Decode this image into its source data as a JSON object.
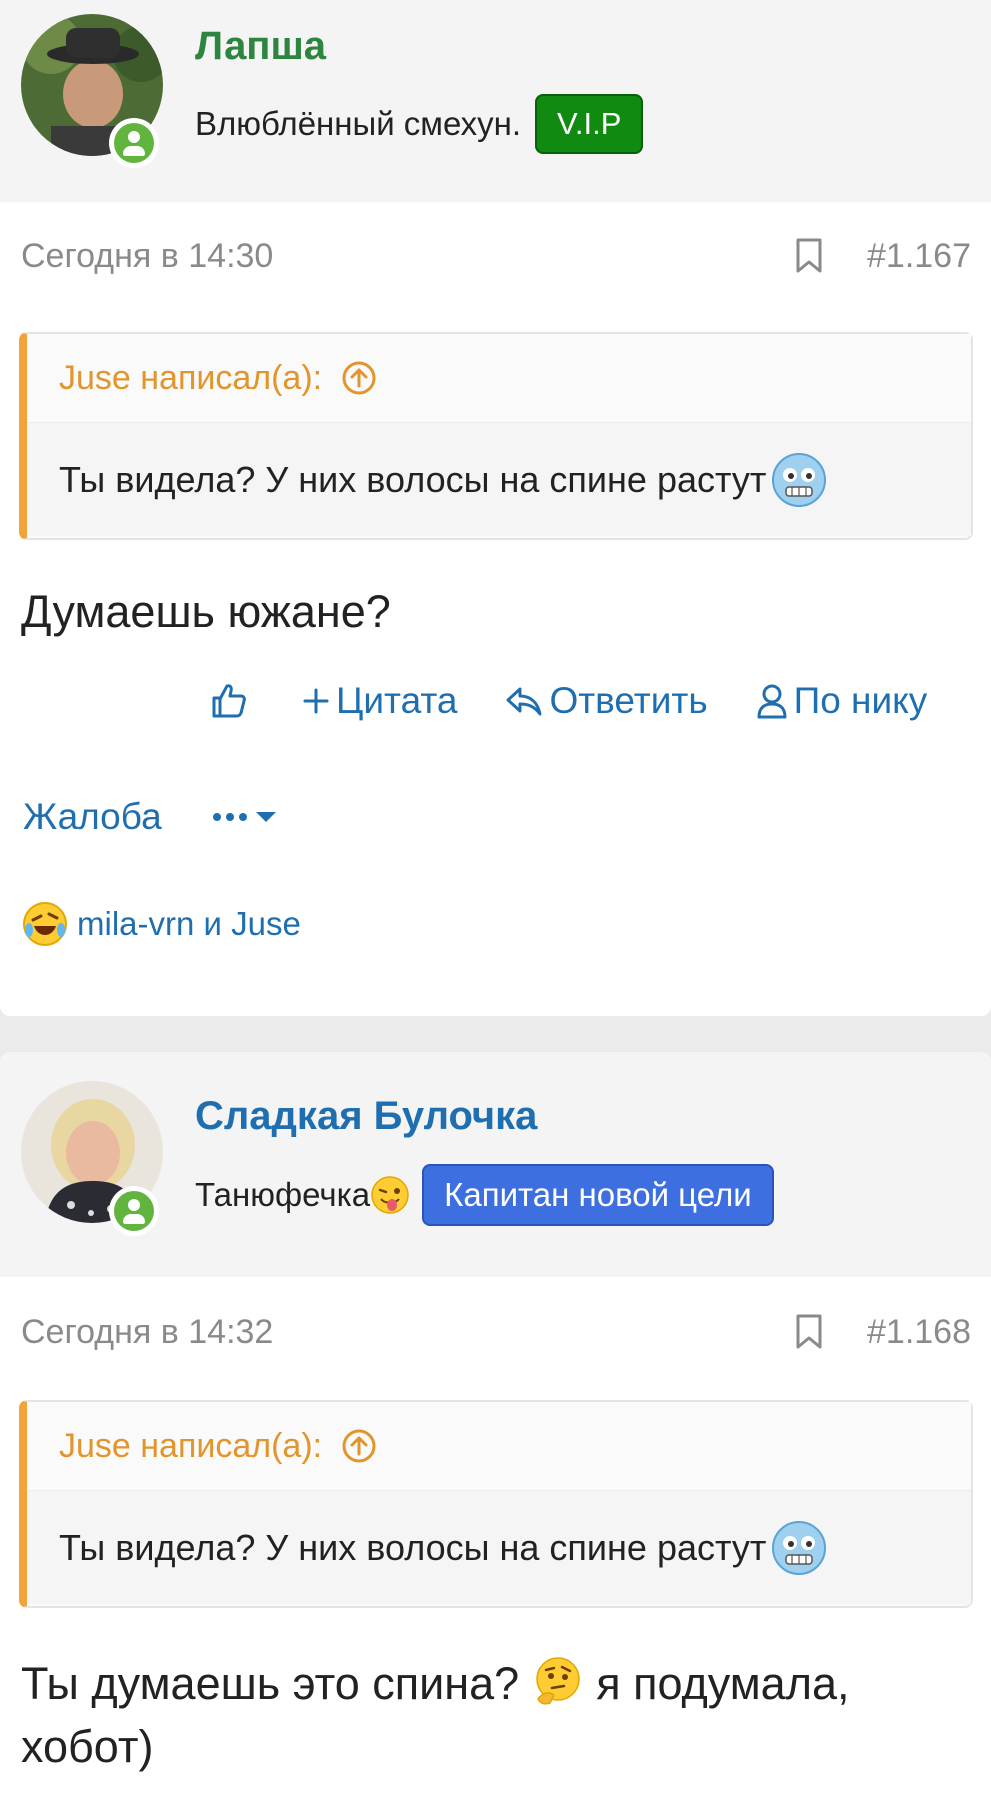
{
  "posts": [
    {
      "username": "Лапша",
      "user_title": "Влюблённый смехун.",
      "badge": "V.I.P",
      "timestamp": "Сегодня в 14:30",
      "post_number": "#1.167",
      "quote": {
        "author_line": "Juse написал(а):",
        "text": "Ты видела? У них волосы на спине растут"
      },
      "message": "Думаешь южане?",
      "actions": {
        "like_label": "",
        "quote_label": "Цитата",
        "reply_label": "Ответить",
        "by_nick_label": "По нику",
        "report_label": "Жалоба"
      },
      "reactions": {
        "text": "mila-vrn и Juse"
      }
    },
    {
      "username": "Сладкая Булочка",
      "user_title": "Танюфечка",
      "badge": "Капитан новой цели",
      "timestamp": "Сегодня в 14:32",
      "post_number": "#1.168",
      "quote": {
        "author_line": "Juse написал(а):",
        "text": "Ты видела? У них волосы на спине растут"
      },
      "message_line1": "Ты думаешь это спина?",
      "message_line1b": "я подумала,",
      "message_line2": "хобот)"
    }
  ],
  "colors": {
    "link": "#1f6fb0",
    "username_green": "#2e8540",
    "vip_green": "#108a10",
    "quote_accent": "#f0a43a",
    "captain_blue": "#3d6fe0"
  }
}
